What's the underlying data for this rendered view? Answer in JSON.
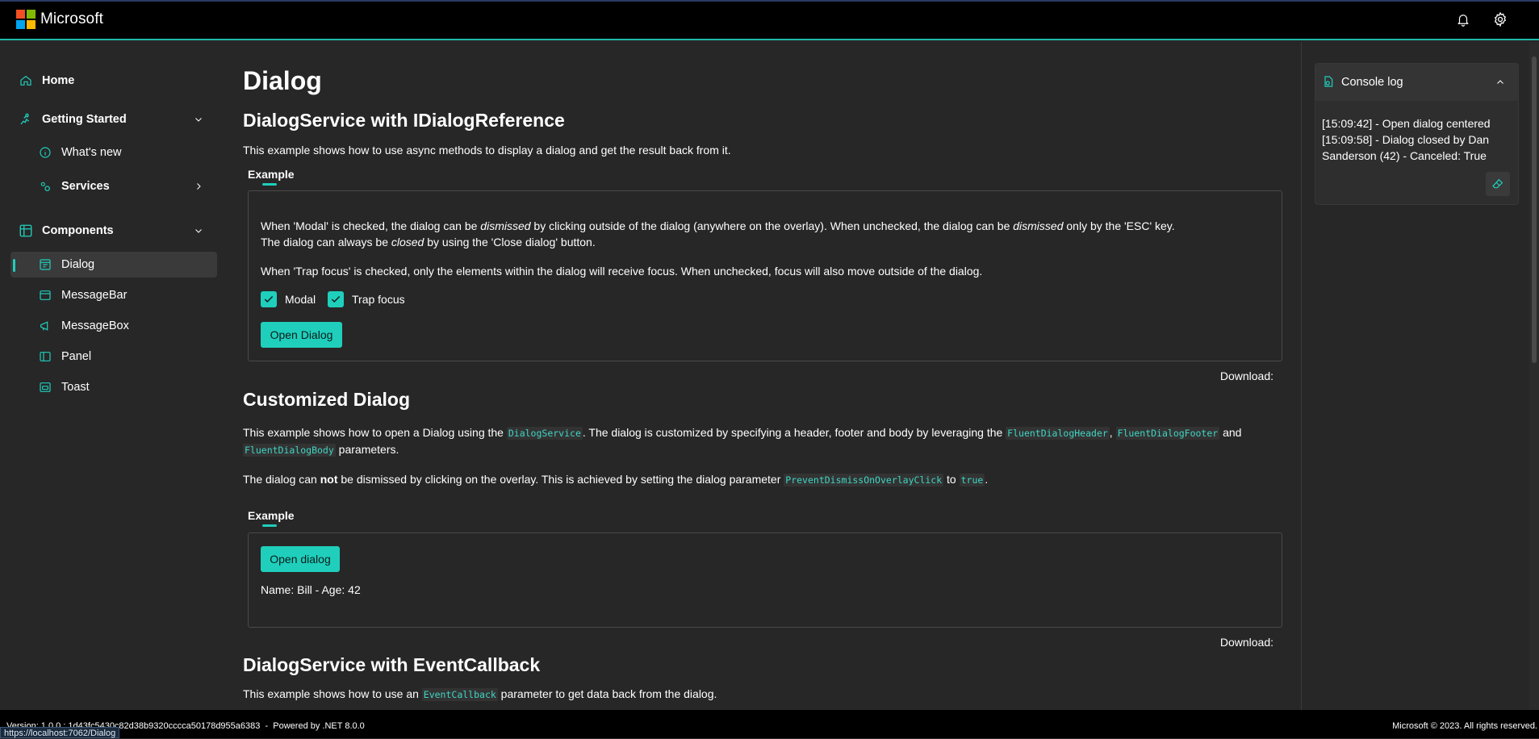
{
  "header": {
    "brand": "Microsoft",
    "logo_colors": [
      "#f25022",
      "#7fba00",
      "#00a4ef",
      "#ffb900"
    ],
    "icons": [
      "bell-icon",
      "gear-icon"
    ]
  },
  "sidebar": {
    "items": [
      {
        "label": "Home",
        "icon": "home-icon"
      },
      {
        "label": "Getting Started",
        "icon": "rocket-icon"
      },
      {
        "label": "What's new",
        "icon": "info-icon"
      },
      {
        "label": "Services",
        "icon": "services-icon"
      },
      {
        "label": "Components",
        "icon": "table-icon"
      },
      {
        "label": "Dialog",
        "icon": "dialog-icon"
      },
      {
        "label": "MessageBar",
        "icon": "window-icon"
      },
      {
        "label": "MessageBox",
        "icon": "megaphone-icon"
      },
      {
        "label": "Panel",
        "icon": "panel-icon"
      },
      {
        "label": "Toast",
        "icon": "toast-icon"
      }
    ]
  },
  "main": {
    "title": "Dialog",
    "section1": {
      "heading": "DialogService with IDialogReference",
      "intro": "This example shows how to use async methods to display a dialog and get the result back from it.",
      "tab": "Example",
      "para1": {
        "a": "When 'Modal' is checked, the dialog can be ",
        "b": "dismissed",
        "c": " by clicking outside of the dialog (anywhere on the overlay). When unchecked, the dialog can be ",
        "d": "dismissed",
        "e": " only by the 'ESC' key."
      },
      "para2": {
        "a": "The dialog can always be ",
        "b": "closed",
        "c": " by using the 'Close dialog' button."
      },
      "para3": "When 'Trap focus' is checked, only the elements within the dialog will receive focus. When unchecked, focus will also move outside of the dialog.",
      "checkbox_modal": "Modal",
      "checkbox_trap": "Trap focus",
      "button": "Open Dialog",
      "download": "Download:"
    },
    "section2": {
      "heading": "Customized Dialog",
      "p1": {
        "a": "This example shows how to open a Dialog using the ",
        "code1": "DialogService",
        "b": ". The dialog is customized by specifying a header, footer and body by leveraging the ",
        "code2": "FluentDialogHeader",
        "c": ", ",
        "code3": "FluentDialogFooter",
        "d": " and",
        "code4": "FluentDialogBody",
        "e": " parameters."
      },
      "p2": {
        "a": "The dialog can ",
        "b": "not",
        "c": " be dismissed by clicking on the overlay. This is achieved by setting the dialog parameter ",
        "code1": "PreventDismissOnOverlayClick",
        "d": " to ",
        "code2": "true",
        "e": "."
      },
      "tab": "Example",
      "button": "Open dialog",
      "result": "Name: Bill - Age: 42",
      "download": "Download:"
    },
    "section3": {
      "heading": "DialogService with EventCallback",
      "p1": {
        "a": "This example shows how to use an ",
        "code1": "EventCallback",
        "b": " parameter to get data back from the dialog."
      }
    }
  },
  "console": {
    "title": "Console log",
    "lines": [
      "[15:09:42] - Open dialog centered",
      "[15:09:58] - Dialog closed by Dan",
      "Sanderson (42) - Canceled: True"
    ]
  },
  "footer": {
    "version": "Version: 1.0.0 : 1d43fc5430c82d38b9320cccca50178d955a6383",
    "powered": "Powered by .NET 8.0.0",
    "copyright": "Microsoft © 2023. All rights reserved.",
    "status_url": "https://localhost:7062/Dialog"
  },
  "colors": {
    "accent": "#1fcfbc",
    "background": "#272727",
    "topbar": "#000000"
  }
}
